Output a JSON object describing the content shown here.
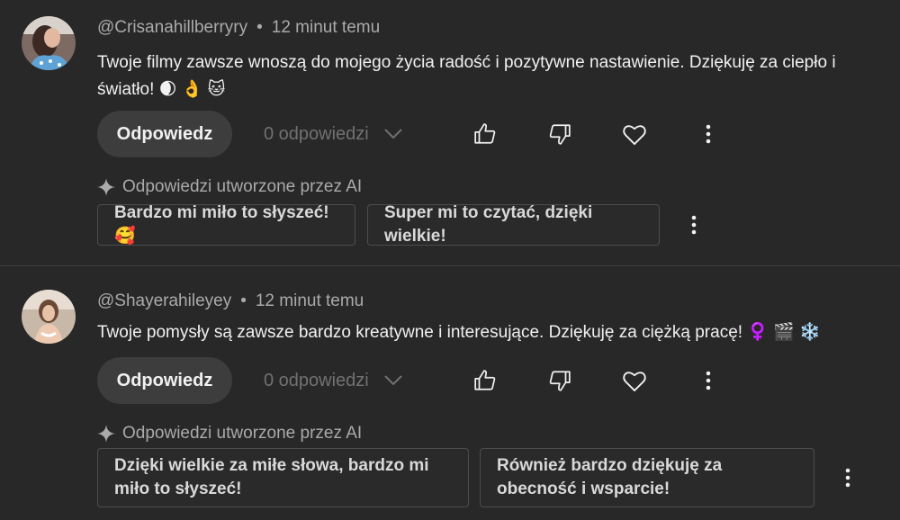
{
  "comments": [
    {
      "author": "@Crisanahillberryry",
      "separator": "•",
      "time": "12 minut temu",
      "text": "Twoje filmy zawsze wnoszą do mojego życia radość i pozytywne nastawienie. Dziękuję za ciepło i światło! 🌒 👌 🐱",
      "reply_label": "Odpowiedz",
      "replies_label": "0 odpowiedzi",
      "ai_label": "Odpowiedzi utworzone przez AI",
      "suggestions": [
        "Bardzo mi miło to słyszeć! 🥰",
        "Super mi to czytać, dzięki wielkie!"
      ]
    },
    {
      "author": "@Shayerahileyey",
      "separator": "•",
      "time": "12 minut temu",
      "text": "Twoje pomysły są zawsze bardzo kreatywne i interesujące. Dziękuję za ciężką pracę! ♀️ 🎬 ❄️",
      "reply_label": "Odpowiedz",
      "replies_label": "0 odpowiedzi",
      "ai_label": "Odpowiedzi utworzone przez AI",
      "suggestions": [
        "Dzięki wielkie za miłe słowa, bardzo mi miło to słyszeć!",
        "Również bardzo dziękuję za obecność i wsparcie!"
      ]
    }
  ],
  "icons": {
    "like": "thumbs-up-icon",
    "dislike": "thumbs-down-icon",
    "heart": "heart-icon",
    "more": "more-vertical-icon",
    "chevron": "chevron-down-icon",
    "sparkle": "sparkle-icon"
  },
  "colors": {
    "background": "#282828",
    "text": "#f1f1f1",
    "secondary": "#aaaaaa",
    "muted": "#717171",
    "button": "#3d3d3d"
  }
}
